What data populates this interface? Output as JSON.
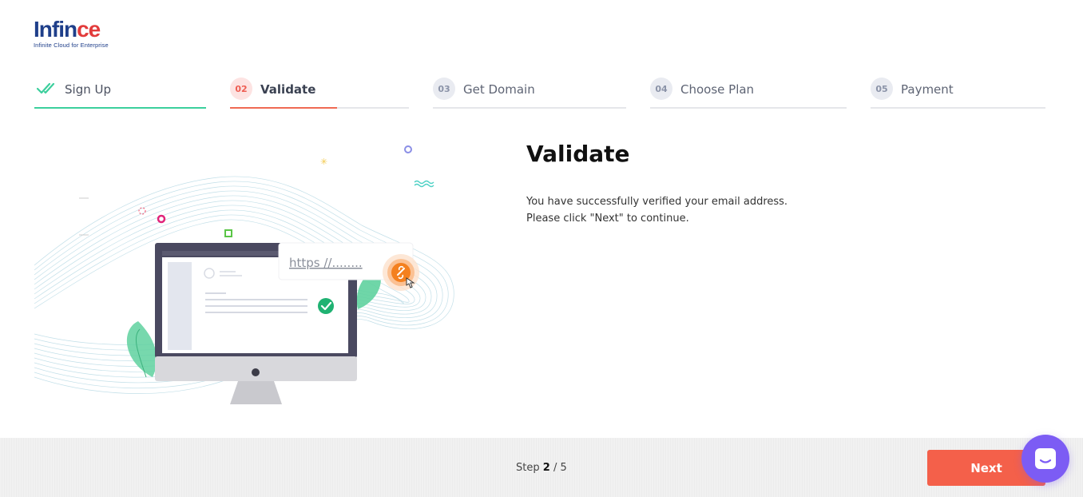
{
  "brand": {
    "name_part1": "Infin",
    "name_part2": "ce",
    "tagline": "Infinite Cloud for Enterprise"
  },
  "steps": [
    {
      "number": "",
      "label": "Sign Up",
      "state": "done"
    },
    {
      "number": "02",
      "label": "Validate",
      "state": "active"
    },
    {
      "number": "03",
      "label": "Get Domain",
      "state": "pending"
    },
    {
      "number": "04",
      "label": "Choose Plan",
      "state": "pending"
    },
    {
      "number": "05",
      "label": "Payment",
      "state": "pending"
    }
  ],
  "illustration": {
    "url_text": "https //........"
  },
  "main": {
    "title": "Validate",
    "line1": "You have successfully verified your email address.",
    "line2": "Please click \"Next\" to continue."
  },
  "footer": {
    "step_prefix": "Step",
    "current_step": "2",
    "separator": "/",
    "total_steps": "5",
    "next_label": "Next"
  },
  "icons": {
    "done_step": "double-check-icon",
    "chat": "chat-bubble-icon"
  },
  "colors": {
    "accent": "#f4604a",
    "done": "#3ccf9d",
    "brand_blue": "#1f3f8a",
    "brand_red": "#e23b3b",
    "chat": "#7c5cf4"
  }
}
